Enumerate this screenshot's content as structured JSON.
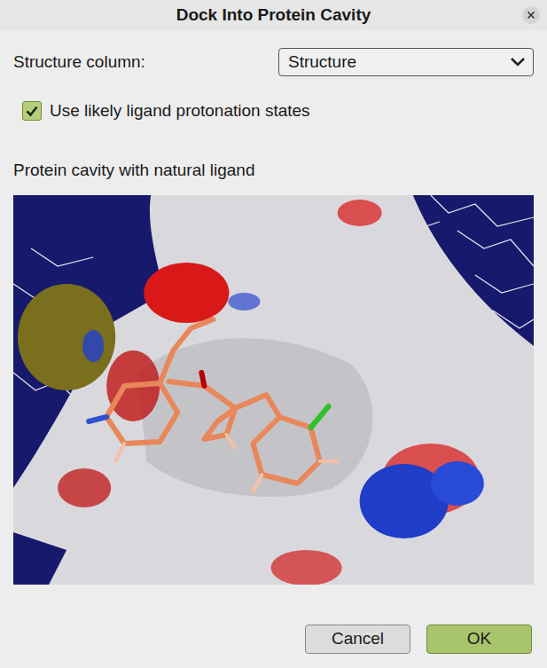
{
  "window": {
    "title": "Dock Into Protein Cavity"
  },
  "structure_column": {
    "label": "Structure column:",
    "value": "Structure"
  },
  "options": [
    {
      "label": "Use likely ligand protonation states",
      "checked": true
    }
  ],
  "preview": {
    "label": "Protein cavity with natural ligand"
  },
  "buttons": [
    {
      "label": "Cancel",
      "primary": false
    },
    {
      "label": "OK",
      "primary": true
    }
  ]
}
